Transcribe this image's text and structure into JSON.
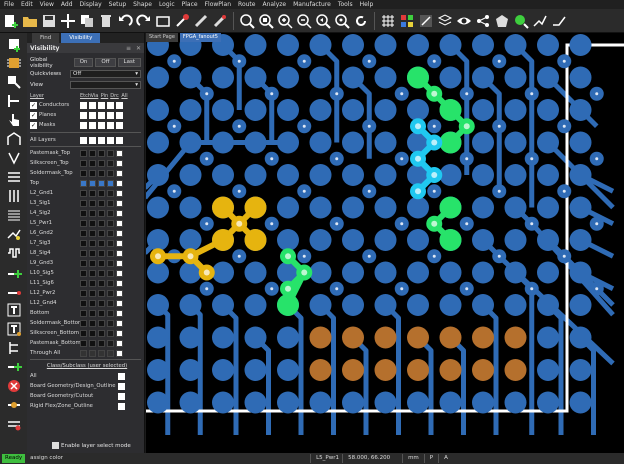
{
  "menu": [
    "File",
    "Edit",
    "View",
    "Add",
    "Display",
    "Setup",
    "Shape",
    "Logic",
    "Place",
    "FlowPlan",
    "Route",
    "Analyze",
    "Manufacture",
    "Tools",
    "Help"
  ],
  "panel": {
    "tabs": [
      "Find",
      "Visibility"
    ],
    "title": "Visibility",
    "title_controls": [
      "≡",
      "✕"
    ],
    "global_visibility": {
      "label": "Global visibility",
      "buttons": [
        "On",
        "Off",
        "Last"
      ]
    },
    "quickviews": {
      "label": "Quickviews",
      "value": "Off"
    },
    "view": {
      "label": "View",
      "value": ""
    },
    "layer_header": {
      "name": "Layer",
      "cols": [
        "Etch",
        "Via",
        "Pin",
        "Drc",
        "All"
      ]
    },
    "top_items": [
      "Conductors",
      "Planes",
      "Masks"
    ],
    "all_layers": "All Layers",
    "layers": [
      "Pastemask_Top",
      "Silkscreen_Top",
      "Soldermask_Top",
      "Top",
      "L2_Gnd1",
      "L3_Sig1",
      "L4_Sig2",
      "L5_Pwr1",
      "L6_Gnd2",
      "L7_Sig3",
      "L8_Sig4",
      "L9_Gnd3",
      "L10_Sig5",
      "L11_Sig6",
      "L12_Pwr2",
      "L12_Gnd4",
      "Bottom",
      "Soldermask_Bottom",
      "Silkscreen_Bottom",
      "Pastemask_Bottom",
      "Through All"
    ],
    "subclass_title": "Class/Subclass (user selected)",
    "subclasses": [
      "All",
      "Board Geometry/Design_Outline",
      "Board Geometry/Cutout",
      "Rigid Flex/Zone_Outline"
    ],
    "enable_label": "Enable layer select mode"
  },
  "doc_tabs": [
    "Start Page",
    "FPGA_fanout5"
  ],
  "status": {
    "ready": "Ready",
    "command": "assign color",
    "layer": "L5_Pwr1",
    "coords": "58.000, 66.200",
    "units": "mm",
    "p": "P",
    "a": "A"
  },
  "colors": {
    "via_blue": "#2f6bb5",
    "yellow": "#e6b40f",
    "green": "#27e36a",
    "cyan": "#20c8f0",
    "copper": "#b5702d",
    "outline": "#ffffff"
  }
}
